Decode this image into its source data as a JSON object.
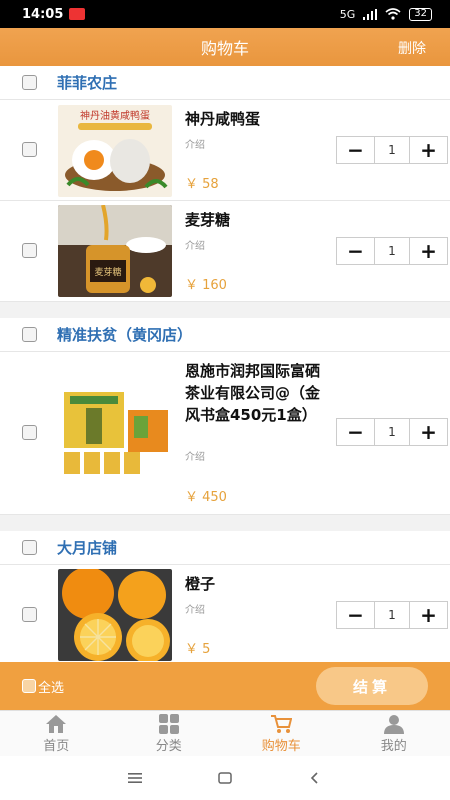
{
  "status_bar": {
    "time": "14:05",
    "network": "5G",
    "battery": "32"
  },
  "header": {
    "title": "购物车",
    "delete_label": "删除"
  },
  "stores": [
    {
      "name": "菲菲农庄",
      "items": [
        {
          "name": "神丹咸鸭蛋",
          "desc": "介绍",
          "price": "￥ 58",
          "qty": "1",
          "image": "salted-duck-egg-image"
        },
        {
          "name": "麦芽糖",
          "desc": "介绍",
          "price": "￥ 160",
          "qty": "1",
          "image": "maltose-jar-image"
        }
      ]
    },
    {
      "name": "精准扶贫（黄冈店）",
      "items": [
        {
          "name": "恩施市润邦国际富硒茶业有限公司@（金风书盒450元1盒）",
          "desc": "介绍",
          "price": "￥ 450",
          "qty": "1",
          "image": "tea-gift-box-image"
        }
      ]
    },
    {
      "name": "大月店铺",
      "items": [
        {
          "name": "橙子",
          "desc": "介绍",
          "price": "￥ 5",
          "qty": "1",
          "image": "orange-fruit-image"
        }
      ]
    }
  ],
  "stepper": {
    "minus": "−",
    "plus": "+"
  },
  "footer": {
    "select_all": "全选",
    "checkout": "结算"
  },
  "tabbar": [
    {
      "label": "首页",
      "icon": "home-icon"
    },
    {
      "label": "分类",
      "icon": "category-icon"
    },
    {
      "label": "购物车",
      "icon": "cart-icon",
      "active": true
    },
    {
      "label": "我的",
      "icon": "profile-icon"
    }
  ],
  "colors": {
    "accent": "#e9963e",
    "store_name": "#2f6fb3",
    "price": "#e6a23c"
  }
}
